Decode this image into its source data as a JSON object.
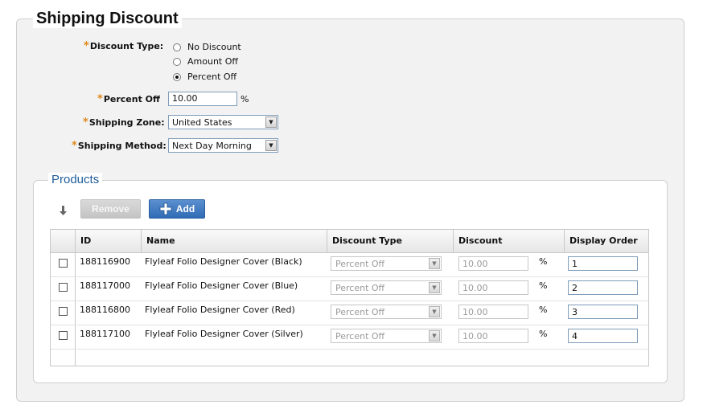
{
  "form": {
    "title": "Shipping Discount",
    "required_mark": "*",
    "discount_type": {
      "label": "Discount Type:",
      "options": [
        "No Discount",
        "Amount Off",
        "Percent Off"
      ],
      "selected": "Percent Off"
    },
    "percent_off": {
      "label": "Percent Off",
      "value": "10.00",
      "unit": "%"
    },
    "shipping_zone": {
      "label": "Shipping Zone:",
      "value": "United States"
    },
    "shipping_method": {
      "label": "Shipping Method:",
      "value": "Next Day Morning"
    }
  },
  "products": {
    "title": "Products",
    "remove_label": "Remove",
    "add_label": "Add",
    "columns": [
      "ID",
      "Name",
      "Discount Type",
      "Discount",
      "Display Order"
    ],
    "rows": [
      {
        "id": "188116900",
        "name": "Flyleaf Folio Designer Cover (Black)",
        "discount_type": "Percent Off",
        "discount": "10.00",
        "unit": "%",
        "order": "1"
      },
      {
        "id": "188117000",
        "name": "Flyleaf Folio Designer Cover (Blue)",
        "discount_type": "Percent Off",
        "discount": "10.00",
        "unit": "%",
        "order": "2"
      },
      {
        "id": "188116800",
        "name": "Flyleaf Folio Designer Cover (Red)",
        "discount_type": "Percent Off",
        "discount": "10.00",
        "unit": "%",
        "order": "3"
      },
      {
        "id": "188117100",
        "name": "Flyleaf Folio Designer Cover (Silver)",
        "discount_type": "Percent Off",
        "discount": "10.00",
        "unit": "%",
        "order": "4"
      }
    ]
  },
  "icons": {
    "sort": "sort-down-arrow-icon",
    "add": "plus-icon",
    "dropdown": "chevron-down-icon"
  },
  "colors": {
    "required": "#e0881a",
    "section_title": "#1f5c99",
    "add_button": "#2f6bb5"
  }
}
